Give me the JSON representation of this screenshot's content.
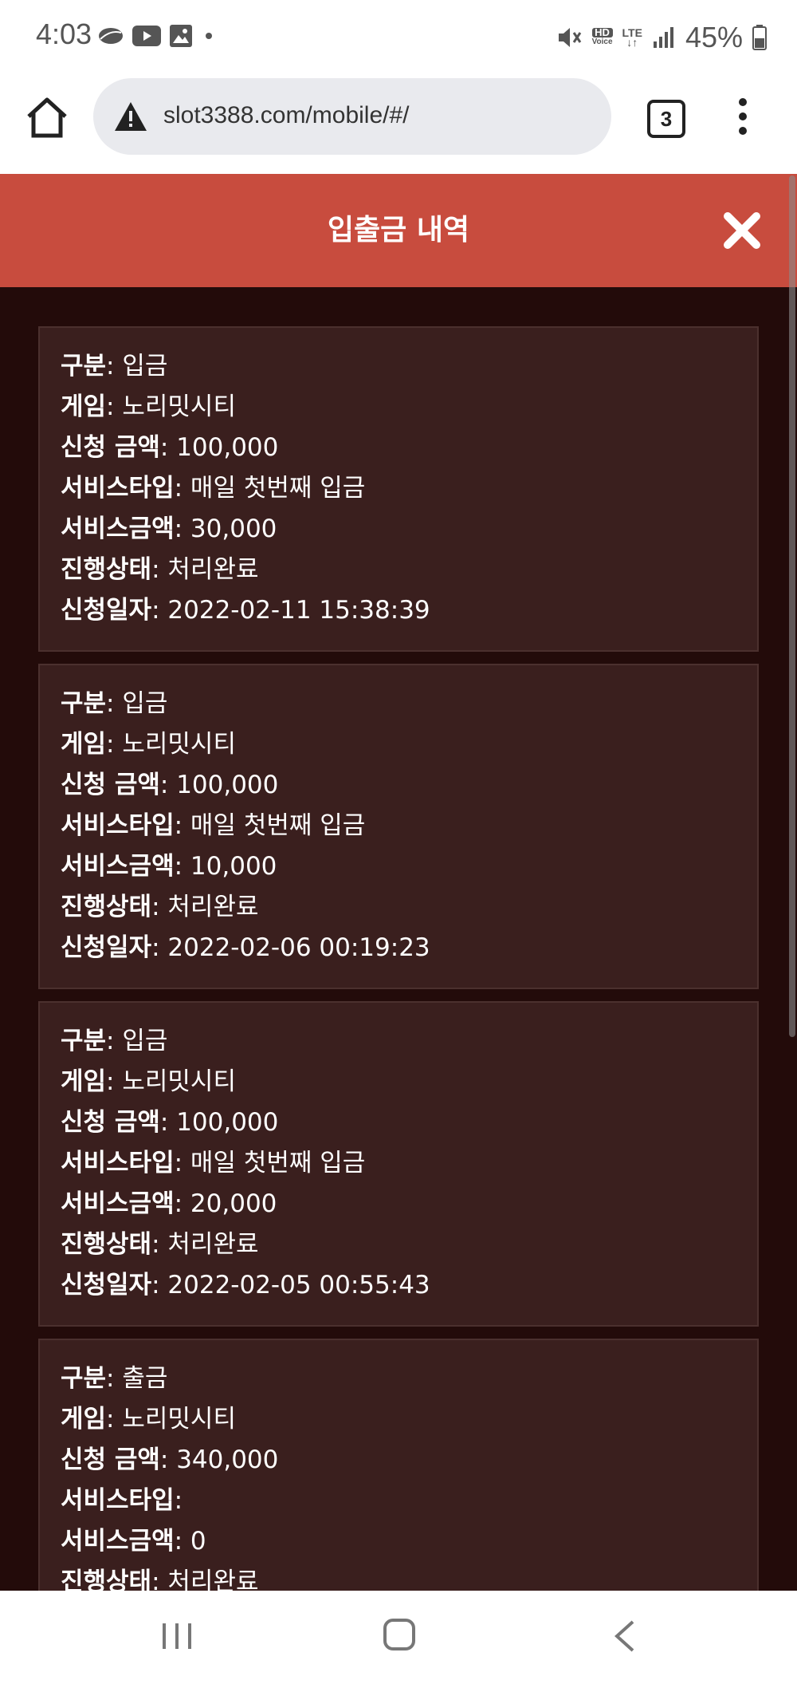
{
  "status_bar": {
    "time": "4:03",
    "battery": "45%",
    "hd_label": "HD",
    "voice_label": "Voice",
    "lte_label": "LTE"
  },
  "browser": {
    "url": "slot3388.com/mobile/#/",
    "tab_count": "3"
  },
  "modal": {
    "title": "입출금 내역",
    "labels": {
      "type": "구분",
      "game": "게임",
      "amount": "신청 금액",
      "service_type": "서비스타입",
      "service_amount": "서비스금액",
      "status": "진행상태",
      "date": "신청일자"
    },
    "records": [
      {
        "type": "입금",
        "game": "노리밋시티",
        "amount": "100,000",
        "service_type": "매일 첫번째 입금",
        "service_amount": "30,000",
        "status": "처리완료",
        "date": "2022-02-11 15:38:39"
      },
      {
        "type": "입금",
        "game": "노리밋시티",
        "amount": "100,000",
        "service_type": "매일 첫번째 입금",
        "service_amount": "10,000",
        "status": "처리완료",
        "date": "2022-02-06 00:19:23"
      },
      {
        "type": "입금",
        "game": "노리밋시티",
        "amount": "100,000",
        "service_type": "매일 첫번째 입금",
        "service_amount": "20,000",
        "status": "처리완료",
        "date": "2022-02-05 00:55:43"
      },
      {
        "type": "출금",
        "game": "노리밋시티",
        "amount": "340,000",
        "service_type": "",
        "service_amount": "0",
        "status": "처리완료",
        "date": ""
      }
    ]
  },
  "colors": {
    "header": "#c84c3e",
    "body_bg": "#230b0a",
    "card_bg": "#3a1f1e"
  }
}
